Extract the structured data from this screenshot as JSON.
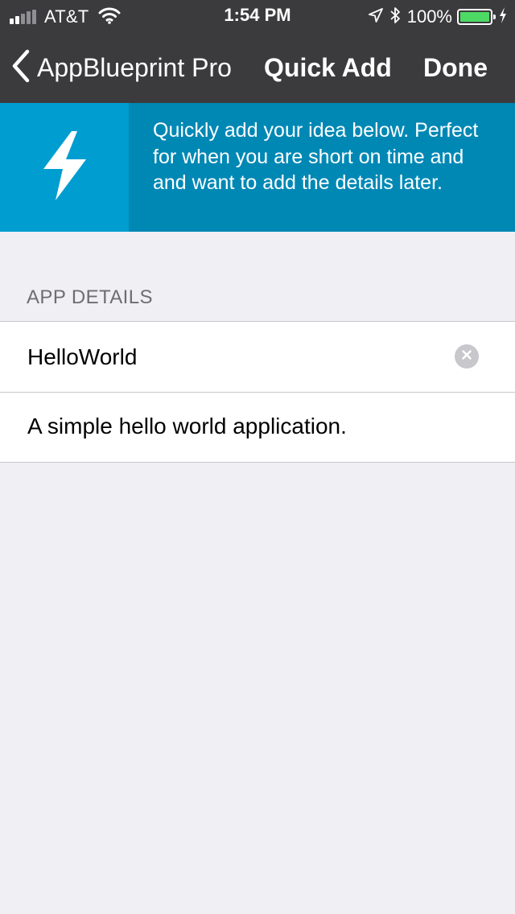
{
  "status_bar": {
    "carrier": "AT&T",
    "time": "1:54 PM",
    "battery_percent": "100%",
    "signal_strength": "2 of 5 bars",
    "battery_level": 1.0,
    "battery_color": "#4cd964"
  },
  "nav": {
    "back_label": "AppBlueprint Pro",
    "title": "Quick Add",
    "done_label": "Done",
    "background_color": "#3b3b3d"
  },
  "banner": {
    "icon": "lightning-bolt-icon",
    "text": "Quickly add your idea below. Perfect for when you are short on time and and want to add the details later.",
    "color": "#0088b5",
    "icon_box_color": "#009dd0"
  },
  "app_details": {
    "section_header": "APP DETAILS",
    "name_value": "HelloWorld",
    "description_value": "A simple hello world application."
  }
}
